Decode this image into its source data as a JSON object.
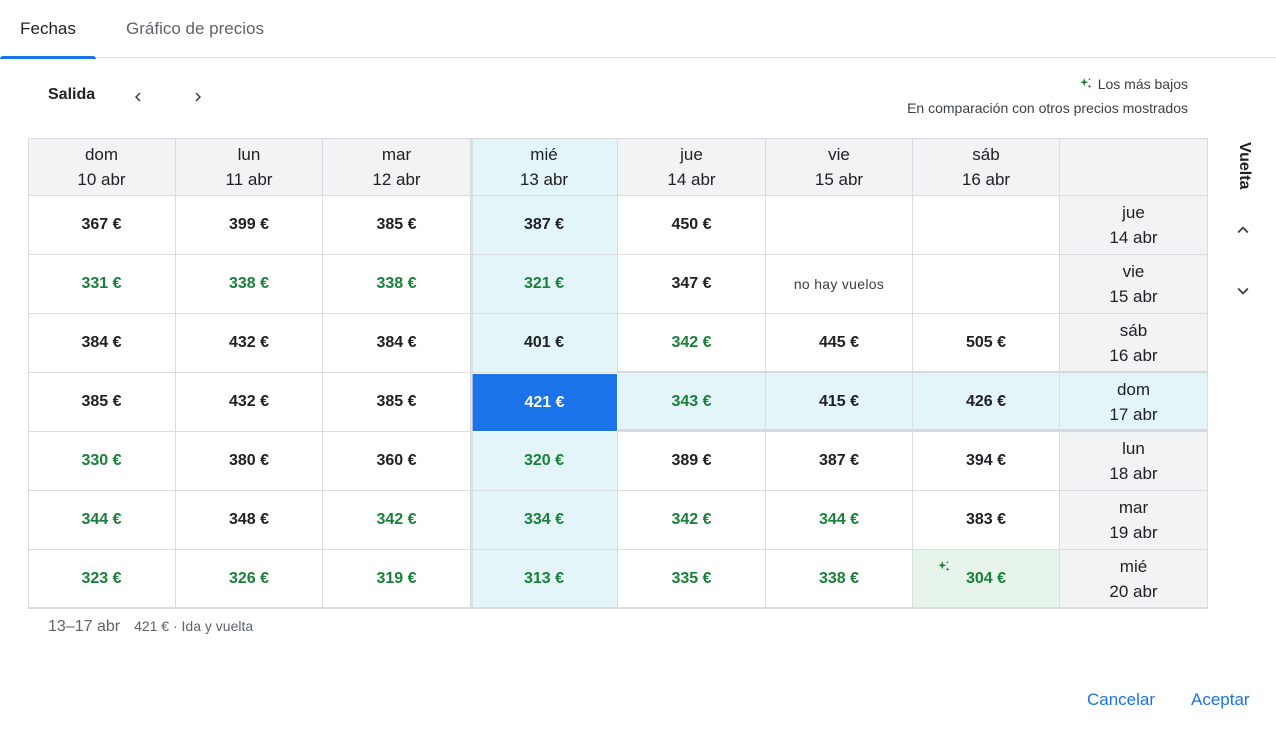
{
  "tabs": [
    {
      "label": "Fechas",
      "active": true
    },
    {
      "label": "Gráfico de precios",
      "active": false
    }
  ],
  "header": {
    "salida_label": "Salida",
    "legend_label": "Los más bajos",
    "legend_note": "En comparación con otros precios mostrados",
    "vuelta_label": "Vuelta"
  },
  "columns": [
    {
      "day": "dom",
      "date": "10 abr"
    },
    {
      "day": "lun",
      "date": "11 abr"
    },
    {
      "day": "mar",
      "date": "12 abr"
    },
    {
      "day": "mié",
      "date": "13 abr"
    },
    {
      "day": "jue",
      "date": "14 abr"
    },
    {
      "day": "vie",
      "date": "15 abr"
    },
    {
      "day": "sáb",
      "date": "16 abr"
    }
  ],
  "rows": [
    {
      "day": "jue",
      "date": "14 abr",
      "cells": [
        {
          "t": "367 €"
        },
        {
          "t": "399 €"
        },
        {
          "t": "385 €"
        },
        {
          "t": "387 €"
        },
        {
          "t": "450 €"
        },
        {
          "t": ""
        },
        {
          "t": ""
        }
      ]
    },
    {
      "day": "vie",
      "date": "15 abr",
      "cells": [
        {
          "t": "331 €",
          "g": true
        },
        {
          "t": "338 €",
          "g": true
        },
        {
          "t": "338 €",
          "g": true
        },
        {
          "t": "321 €",
          "g": true
        },
        {
          "t": "347 €"
        },
        {
          "t": "no hay vuelos",
          "nf": true
        },
        {
          "t": ""
        }
      ]
    },
    {
      "day": "sáb",
      "date": "16 abr",
      "cells": [
        {
          "t": "384 €"
        },
        {
          "t": "432 €"
        },
        {
          "t": "384 €"
        },
        {
          "t": "401 €"
        },
        {
          "t": "342 €",
          "g": true
        },
        {
          "t": "445 €"
        },
        {
          "t": "505 €"
        }
      ]
    },
    {
      "day": "dom",
      "date": "17 abr",
      "cells": [
        {
          "t": "385 €"
        },
        {
          "t": "432 €"
        },
        {
          "t": "385 €"
        },
        {
          "t": "421 €",
          "sel": true
        },
        {
          "t": "343 €",
          "g": true
        },
        {
          "t": "415 €"
        },
        {
          "t": "426 €"
        }
      ]
    },
    {
      "day": "lun",
      "date": "18 abr",
      "cells": [
        {
          "t": "330 €",
          "g": true
        },
        {
          "t": "380 €"
        },
        {
          "t": "360 €"
        },
        {
          "t": "320 €",
          "g": true
        },
        {
          "t": "389 €"
        },
        {
          "t": "387 €"
        },
        {
          "t": "394 €"
        }
      ]
    },
    {
      "day": "mar",
      "date": "19 abr",
      "cells": [
        {
          "t": "344 €",
          "g": true
        },
        {
          "t": "348 €"
        },
        {
          "t": "342 €",
          "g": true
        },
        {
          "t": "334 €",
          "g": true
        },
        {
          "t": "342 €",
          "g": true
        },
        {
          "t": "344 €",
          "g": true
        },
        {
          "t": "383 €"
        }
      ]
    },
    {
      "day": "mié",
      "date": "20 abr",
      "cells": [
        {
          "t": "323 €",
          "g": true
        },
        {
          "t": "326 €",
          "g": true
        },
        {
          "t": "319 €",
          "g": true
        },
        {
          "t": "313 €",
          "g": true
        },
        {
          "t": "335 €",
          "g": true
        },
        {
          "t": "338 €",
          "g": true
        },
        {
          "t": "304 €",
          "g": true,
          "best": true
        }
      ]
    }
  ],
  "selected": {
    "col": 3,
    "row": 3
  },
  "summary": {
    "dates": "13–17 abr",
    "price": "421 € · Ida y vuelta"
  },
  "actions": {
    "cancel": "Cancelar",
    "accept": "Aceptar"
  },
  "colors": {
    "accent": "#1a73e8",
    "green": "#188038",
    "highlight": "#e3f5f9",
    "best_bg": "#e6f4ea",
    "header_bg": "#f1f3f4"
  },
  "icons": {
    "prev": "chevron-left-icon",
    "next": "chevron-right-icon",
    "sparkle": "sparkle-icon",
    "up": "chevron-up-icon",
    "down": "chevron-down-icon"
  }
}
